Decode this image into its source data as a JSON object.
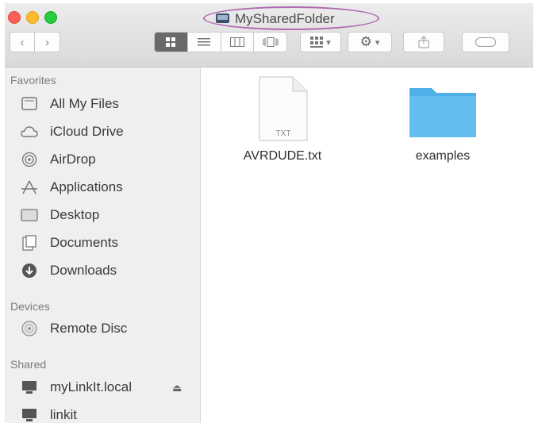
{
  "window": {
    "title": "MySharedFolder"
  },
  "toolbar": {
    "back_icon": "chevron-left-icon",
    "forward_icon": "chevron-right-icon",
    "views": [
      "icon-view",
      "list-view",
      "column-view",
      "cover-flow-view"
    ],
    "arrange_icon": "arrange-grid-icon",
    "action_icon": "gear-icon",
    "share_icon": "share-icon",
    "tags_icon": "tag-icon"
  },
  "sidebar": {
    "favorites_label": "Favorites",
    "favorites": [
      {
        "label": "All My Files",
        "icon": "all-files-icon"
      },
      {
        "label": "iCloud Drive",
        "icon": "cloud-icon"
      },
      {
        "label": "AirDrop",
        "icon": "airdrop-icon"
      },
      {
        "label": "Applications",
        "icon": "applications-icon"
      },
      {
        "label": "Desktop",
        "icon": "desktop-icon"
      },
      {
        "label": "Documents",
        "icon": "documents-icon"
      },
      {
        "label": "Downloads",
        "icon": "downloads-icon"
      }
    ],
    "devices_label": "Devices",
    "devices": [
      {
        "label": "Remote Disc",
        "icon": "disc-icon"
      }
    ],
    "shared_label": "Shared",
    "shared": [
      {
        "label": "myLinkIt.local",
        "icon": "computer-icon",
        "eject": "⏏"
      },
      {
        "label": "linkit",
        "icon": "computer-icon"
      }
    ]
  },
  "content": {
    "files": [
      {
        "name": "AVRDUDE.txt",
        "type_label": "TXT"
      },
      {
        "name": "examples"
      }
    ]
  },
  "colors": {
    "folder": "#5ab6ea",
    "title_highlight": "#b06ab0"
  }
}
